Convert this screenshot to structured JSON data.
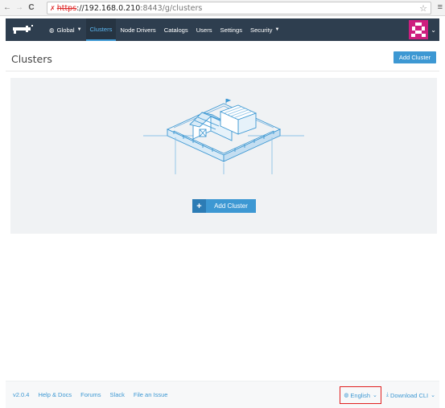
{
  "browser": {
    "back": "←",
    "forward": "→",
    "reload": "C",
    "url_scheme": "https",
    "url_host": "://192.168.0.210",
    "url_path": ":8443/g/clusters"
  },
  "header": {
    "nav": [
      {
        "label": "Global"
      },
      {
        "label": "Clusters"
      },
      {
        "label": "Node Drivers"
      },
      {
        "label": "Catalogs"
      },
      {
        "label": "Users"
      },
      {
        "label": "Settings"
      },
      {
        "label": "Security"
      }
    ]
  },
  "page": {
    "title": "Clusters",
    "add_button": "Add Cluster"
  },
  "empty_state": {
    "add_button": "Add Cluster"
  },
  "footer": {
    "version": "v2.0.4",
    "links": [
      "Help & Docs",
      "Forums",
      "Slack",
      "File an Issue"
    ],
    "language": "English",
    "download": "Download CLI"
  },
  "colors": {
    "header_bg": "#2e3e4f",
    "accent": "#3d98d3",
    "avatar": "#ce1f7f",
    "highlight_box": "#e02020"
  }
}
